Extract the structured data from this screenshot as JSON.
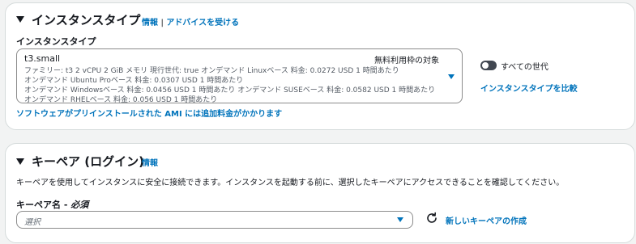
{
  "instance_type": {
    "title": "インスタンスタイプ",
    "info_link": "情報",
    "separator": "|",
    "advice_link": "アドバイスを受ける",
    "field_label": "インスタンスタイプ",
    "selected": {
      "name": "t3.small",
      "free_tier_badge": "無料利用枠の対象",
      "line1": "ファミリー: t3 2 vCPU 2 GiB メモリ 現行世代: true オンデマンド Linuxベース 料金: 0.0272 USD 1 時間あたり",
      "line2": "オンデマンド Ubuntu Proベース 料金: 0.0307 USD 1 時間あたり",
      "line3": "オンデマンド Windowsベース 料金: 0.0456 USD 1 時間あたり オンデマンド SUSEベース 料金: 0.0582 USD 1 時間あたり",
      "line4": "オンデマンド RHELベース 料金: 0.056 USD 1 時間あたり"
    },
    "all_generations_toggle": "すべての世代",
    "compare_link": "インスタンスタイプを比較",
    "ami_notice": "ソフトウェアがプリインストールされた AMI には追加料金がかかります"
  },
  "key_pair": {
    "title": "キーペア (ログイン)",
    "info_link": "情報",
    "description": "キーペアを使用してインスタンスに安全に接続できます。インスタンスを起動する前に、選択したキーペアにアクセスできることを確認してください。",
    "field_label": "キーペア名 - ",
    "required": "必須",
    "select_placeholder": "選択",
    "create_link": "新しいキーペアの作成"
  }
}
